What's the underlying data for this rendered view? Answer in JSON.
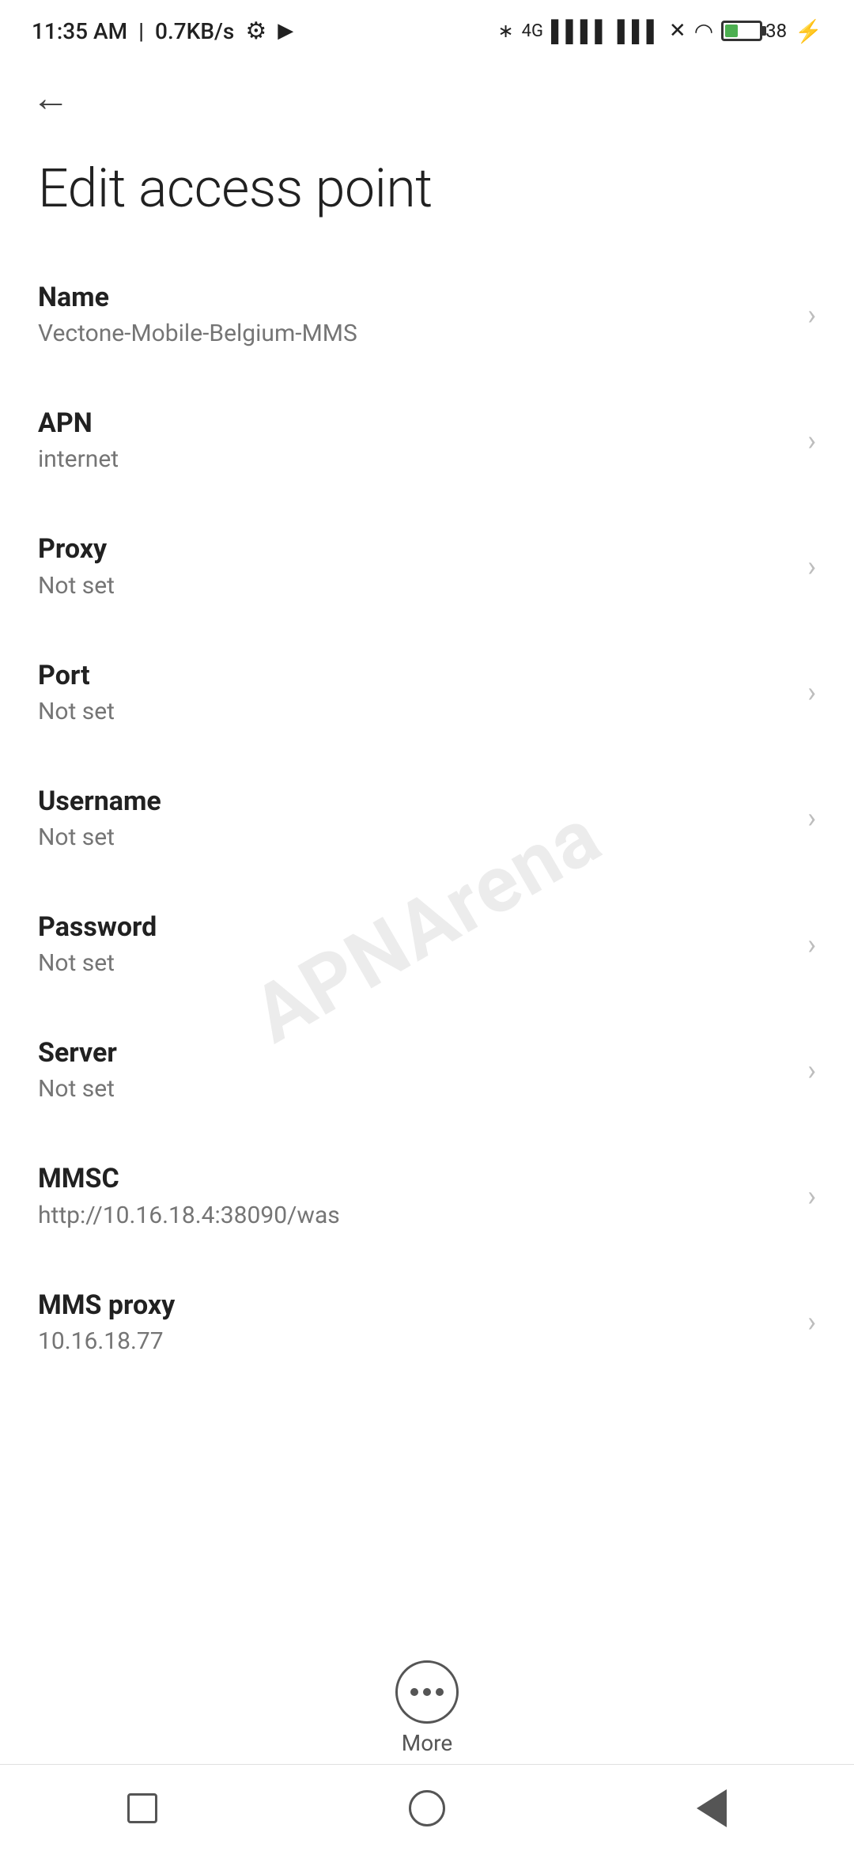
{
  "statusBar": {
    "time": "11:35 AM",
    "network": "0.7KB/s",
    "battery": "38"
  },
  "header": {
    "backLabel": "←",
    "title": "Edit access point"
  },
  "settings": {
    "items": [
      {
        "label": "Name",
        "value": "Vectone-Mobile-Belgium-MMS"
      },
      {
        "label": "APN",
        "value": "internet"
      },
      {
        "label": "Proxy",
        "value": "Not set"
      },
      {
        "label": "Port",
        "value": "Not set"
      },
      {
        "label": "Username",
        "value": "Not set"
      },
      {
        "label": "Password",
        "value": "Not set"
      },
      {
        "label": "Server",
        "value": "Not set"
      },
      {
        "label": "MMSC",
        "value": "http://10.16.18.4:38090/was"
      },
      {
        "label": "MMS proxy",
        "value": "10.16.18.77"
      }
    ]
  },
  "moreButton": {
    "label": "More"
  },
  "watermark": "APNArena"
}
